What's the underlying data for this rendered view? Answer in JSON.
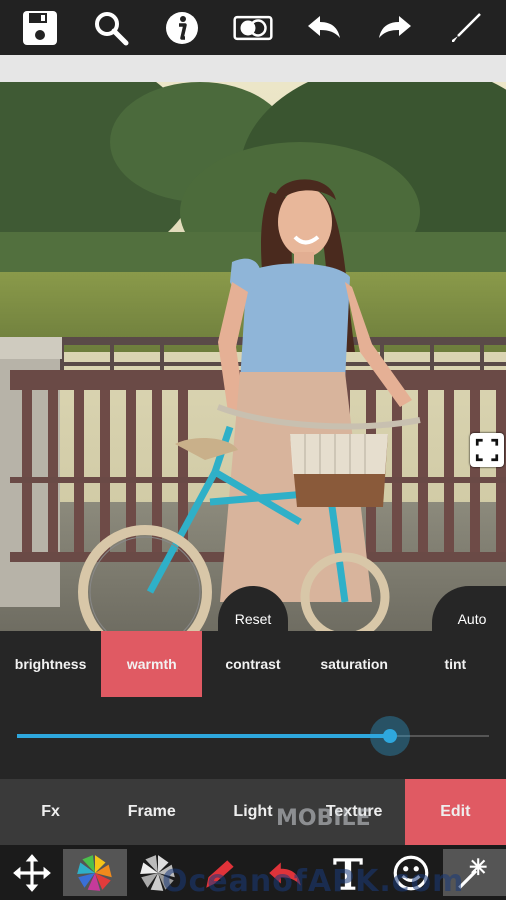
{
  "topbar": {
    "icons": [
      "save-icon",
      "search-icon",
      "info-icon",
      "compare-icon",
      "undo-icon",
      "redo-icon",
      "brush-icon"
    ]
  },
  "photo": {
    "description_icon": "photo-canvas",
    "fullscreen_icon": "expand-icon"
  },
  "buttons": {
    "reset": "Reset",
    "auto": "Auto"
  },
  "adjust_tabs": [
    {
      "label": "brightness",
      "active": false
    },
    {
      "label": "warmth",
      "active": true
    },
    {
      "label": "contrast",
      "active": false
    },
    {
      "label": "saturation",
      "active": false
    },
    {
      "label": "tint",
      "active": false
    }
  ],
  "slider": {
    "value_fraction": 0.79,
    "accent": "#2ea7dd"
  },
  "mode_tabs": [
    {
      "label": "Fx",
      "active": false
    },
    {
      "label": "Frame",
      "active": false
    },
    {
      "label": "Light",
      "active": false
    },
    {
      "label": "Texture",
      "active": false
    },
    {
      "label": "Edit",
      "active": true
    }
  ],
  "toolbar": {
    "icons": [
      "move-icon",
      "color-flower-icon",
      "gray-flower-icon",
      "red-brush-icon",
      "red-undo-brush-icon",
      "text-icon",
      "smiley-icon",
      "sparkle-brush-icon"
    ]
  },
  "watermark": {
    "top": "MOBILE",
    "bottom": "OceanofAPK.com"
  },
  "colors": {
    "accent": "#e05a63",
    "slider": "#2ea7dd"
  }
}
